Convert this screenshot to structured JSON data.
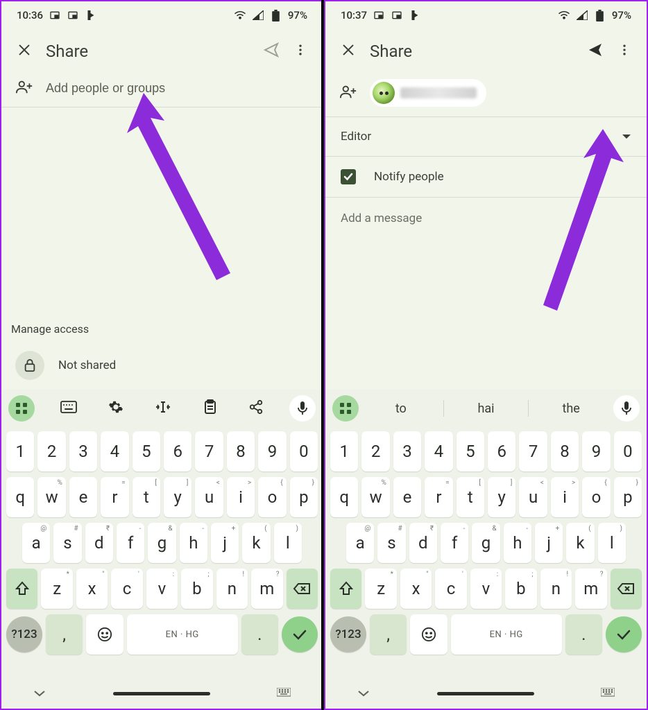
{
  "left": {
    "status": {
      "time": "10:36",
      "battery": "97%"
    },
    "toolbar": {
      "title": "Share"
    },
    "people": {
      "placeholder": "Add people or groups"
    },
    "manage": {
      "label": "Manage access",
      "status": "Not shared"
    }
  },
  "right": {
    "status": {
      "time": "10:37",
      "battery": "97%"
    },
    "toolbar": {
      "title": "Share"
    },
    "role": {
      "selected": "Editor"
    },
    "notify": {
      "label": "Notify people"
    },
    "message": {
      "placeholder": "Add a message"
    },
    "suggestions": [
      "to",
      "hai",
      "the"
    ]
  },
  "keyboard": {
    "row1": [
      "1",
      "2",
      "3",
      "4",
      "5",
      "6",
      "7",
      "8",
      "9",
      "0"
    ],
    "row2": [
      "q",
      "w",
      "e",
      "r",
      "t",
      "y",
      "u",
      "i",
      "o",
      "p"
    ],
    "row2sup": [
      "",
      "%",
      "",
      "=",
      "[",
      "]",
      "<",
      ">",
      "{",
      "}"
    ],
    "row3": [
      "a",
      "s",
      "d",
      "f",
      "g",
      "h",
      "j",
      "k",
      "l"
    ],
    "row3sup": [
      "@",
      "#",
      "₹",
      "-",
      "&",
      "-",
      "+",
      "(",
      ")"
    ],
    "row4": [
      "z",
      "x",
      "c",
      "v",
      "b",
      "n",
      "m"
    ],
    "row4sup": [
      "*",
      "\"",
      "'",
      ":",
      ";",
      "!",
      "?"
    ],
    "space": "EN · HG",
    "sym": "?123",
    "comma": ",",
    "period": "."
  }
}
